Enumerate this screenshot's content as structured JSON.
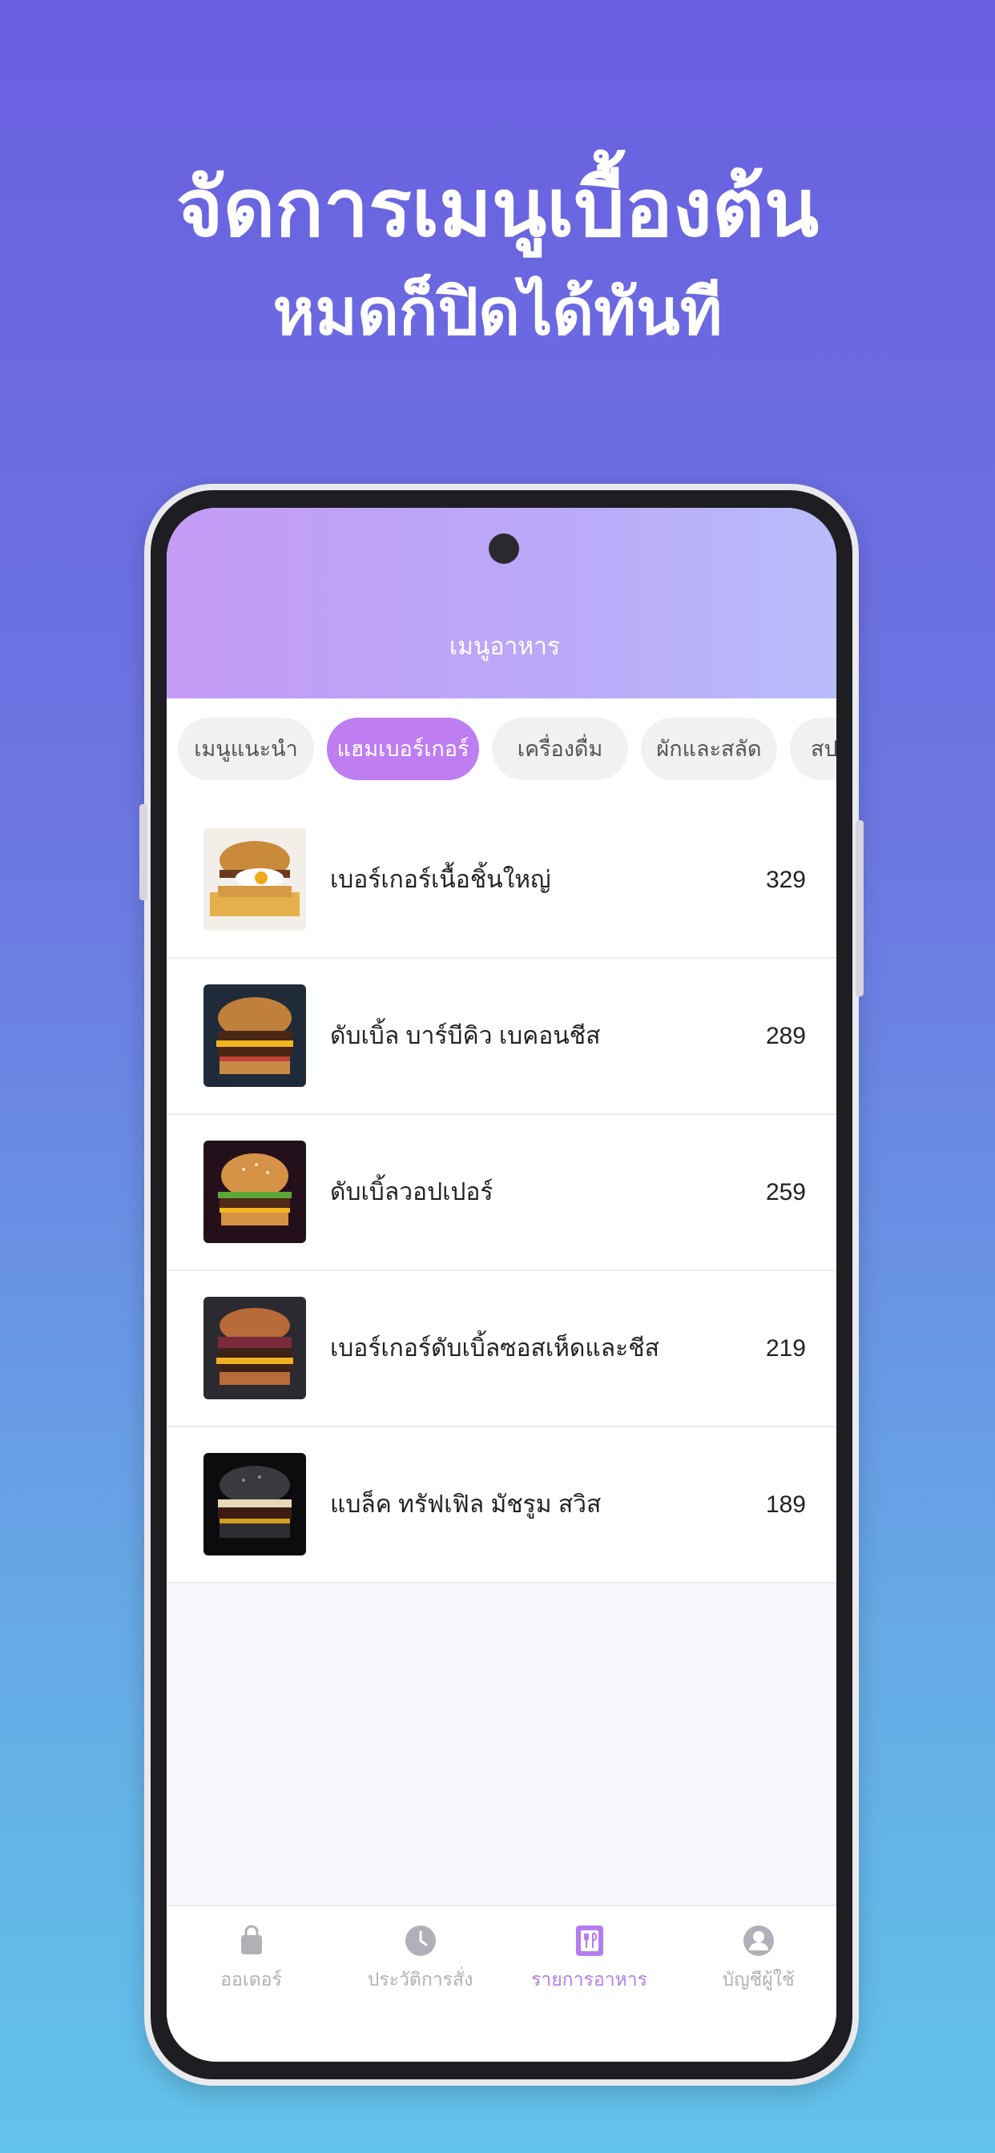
{
  "promo": {
    "headline_line1": "จัดการเมนูเบื้องต้น",
    "headline_line2": "หมดก็ปิดได้ทันที"
  },
  "app": {
    "title": "เมนูอาหาร"
  },
  "tabs": [
    {
      "label": "เมนูแนะนำ",
      "active": false
    },
    {
      "label": "แฮมเบอร์เกอร์",
      "active": true
    },
    {
      "label": "เครื่องดื่ม",
      "active": false
    },
    {
      "label": "ผักและสลัด",
      "active": false
    },
    {
      "label": "สป",
      "active": false
    }
  ],
  "menu_items": [
    {
      "name": "เบอร์เกอร์เนื้อชิ้นใหญ่",
      "price": "329",
      "image": "burger-egg-fries"
    },
    {
      "name": "ดับเบิ้ล บาร์บีคิว เบคอนชีส",
      "price": "289",
      "image": "double-bbq-burger"
    },
    {
      "name": "ดับเบิ้ลวอปเปอร์",
      "price": "259",
      "image": "double-whopper"
    },
    {
      "name": "เบอร์เกอร์ดับเบิ้ลซอสเห็ดและชีส",
      "price": "219",
      "image": "mushroom-cheese-burger"
    },
    {
      "name": "แบล็ค ทรัฟเฟิล มัชรูม สวิส",
      "price": "189",
      "image": "black-truffle-burger"
    }
  ],
  "bottom_nav": [
    {
      "label": "ออเดอร์",
      "icon": "shopping-bag-icon",
      "active": false
    },
    {
      "label": "ประวัติการสั่ง",
      "icon": "clock-icon",
      "active": false
    },
    {
      "label": "รายการอาหาร",
      "icon": "menu-book-icon",
      "active": true
    },
    {
      "label": "บัญชีผู้ใช้",
      "icon": "user-account-icon",
      "active": false
    }
  ],
  "colors": {
    "accent": "#bf7df2",
    "inactive_nav": "#b0b0b8"
  }
}
